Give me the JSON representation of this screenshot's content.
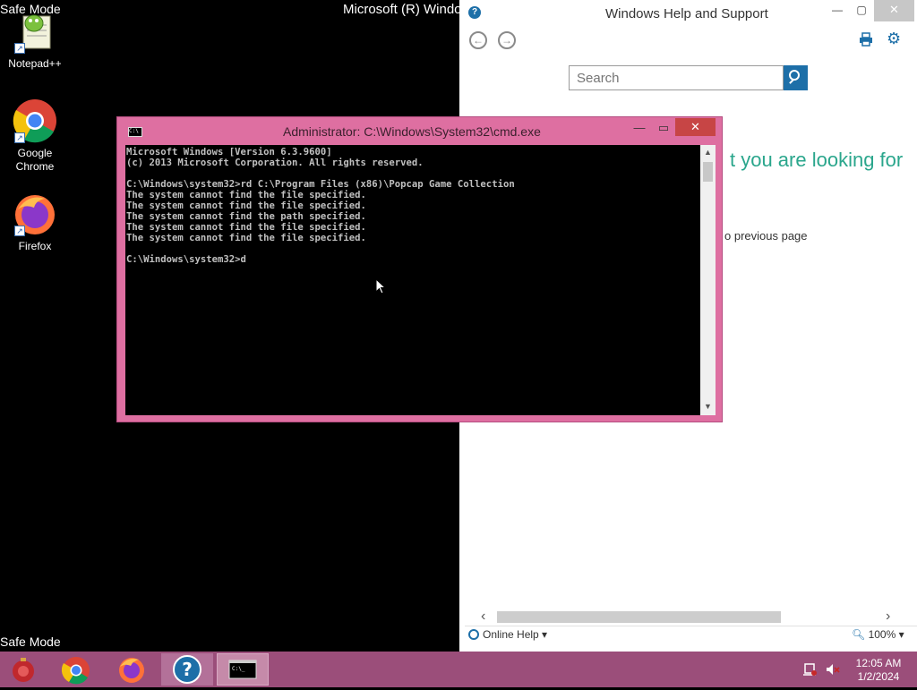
{
  "safe_mode": {
    "top_left": "Safe Mode",
    "bottom_left": "Safe Mode",
    "top_center": "Microsoft (R) Windo"
  },
  "desktop_icons": [
    {
      "name": "notepadpp",
      "label": "Notepad++"
    },
    {
      "name": "chrome",
      "label": "Google Chrome"
    },
    {
      "name": "firefox",
      "label": "Firefox"
    }
  ],
  "help": {
    "title": "Windows Help and Support",
    "search_placeholder": "Search",
    "heading_fragment": "t you are looking for",
    "link_fragment": "o previous page",
    "online_help": "Online Help",
    "zoom": "100%"
  },
  "cmd": {
    "title": "Administrator: C:\\Windows\\System32\\cmd.exe",
    "icon_text": "C:\\",
    "lines": [
      "Microsoft Windows [Version 6.3.9600]",
      "(c) 2013 Microsoft Corporation. All rights reserved.",
      "",
      "C:\\Windows\\system32>rd C:\\Program Files (x86)\\Popcap Game Collection",
      "The system cannot find the file specified.",
      "The system cannot find the file specified.",
      "The system cannot find the path specified.",
      "The system cannot find the file specified.",
      "The system cannot find the file specified.",
      "",
      "C:\\Windows\\system32>d"
    ]
  },
  "taskbar": {
    "time": "12:05 AM",
    "date": "1/2/2024"
  },
  "colors": {
    "accent": "#9b4e7a",
    "cmd_frame": "#de6fa1",
    "help_blue": "#1d6fa8",
    "help_green": "#2aa68c"
  }
}
